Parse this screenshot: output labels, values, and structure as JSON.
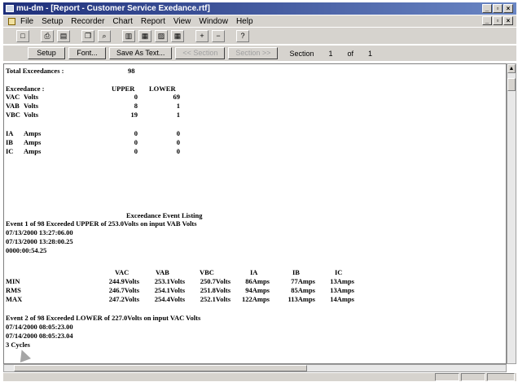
{
  "window": {
    "title": "mu-dm - [Report - Customer Service Exedance.rtf]"
  },
  "menu": [
    "File",
    "Setup",
    "Recorder",
    "Chart",
    "Report",
    "View",
    "Window",
    "Help"
  ],
  "toolbar_icons": [
    "new-icon",
    "print-icon",
    "print-preview-icon",
    "copy-icon",
    "find-icon",
    "tile-icon",
    "cascade-icon",
    "chart-icon",
    "table-icon",
    "zoom-in-icon",
    "zoom-out-icon",
    "help-icon"
  ],
  "buttons": {
    "setup": "Setup",
    "font": "Font...",
    "save_as_text": "Save As Text...",
    "prev_section": "<< Section",
    "next_section": "Section >>",
    "section_label": "Section",
    "section_current": "1",
    "section_of": "of",
    "section_total": "1"
  },
  "report": {
    "total_label": "Total Exceedances :",
    "total_value": "98",
    "exceedance_label": "Exceedance :",
    "col_upper": "UPPER",
    "col_lower": "LOWER",
    "summary_rows": [
      {
        "ch": "VAC",
        "unit": "Volts",
        "upper": "0",
        "lower": "69"
      },
      {
        "ch": "VAB",
        "unit": "Volts",
        "upper": "8",
        "lower": "1"
      },
      {
        "ch": "VBC",
        "unit": "Volts",
        "upper": "19",
        "lower": "1"
      },
      {
        "ch": "IA",
        "unit": "Amps",
        "upper": "0",
        "lower": "0"
      },
      {
        "ch": "IB",
        "unit": "Amps",
        "upper": "0",
        "lower": "0"
      },
      {
        "ch": "IC",
        "unit": "Amps",
        "upper": "0",
        "lower": "0"
      }
    ],
    "listing_title": "Exceedance Event Listing",
    "event1": {
      "header": "Event 1 of 98 Exceeded UPPER of 253.0Volts on input VAB Volts",
      "start": "07/13/2000 13:27:06.00",
      "end": "07/13/2000 13:28:00.25",
      "duration": "0000:00:54.25"
    },
    "stats_cols": [
      "VAC",
      "VAB",
      "VBC",
      "IA",
      "IB",
      "IC"
    ],
    "stats_rows": [
      {
        "label": "MIN",
        "vals": [
          "244.9Volts",
          "253.1Volts",
          "250.7Volts",
          "86Amps",
          "77Amps",
          "13Amps"
        ]
      },
      {
        "label": "RMS",
        "vals": [
          "246.7Volts",
          "254.1Volts",
          "251.8Volts",
          "94Amps",
          "85Amps",
          "13Amps"
        ]
      },
      {
        "label": "MAX",
        "vals": [
          "247.2Volts",
          "254.4Volts",
          "252.1Volts",
          "122Amps",
          "113Amps",
          "14Amps"
        ]
      }
    ],
    "event2": {
      "header": "Event 2 of 98 Exceeded LOWER of 227.0Volts on input VAC Volts",
      "start": "07/14/2000 08:05:23.00",
      "end": "07/14/2000 08:05:23.04",
      "duration": "3 Cycles"
    }
  }
}
